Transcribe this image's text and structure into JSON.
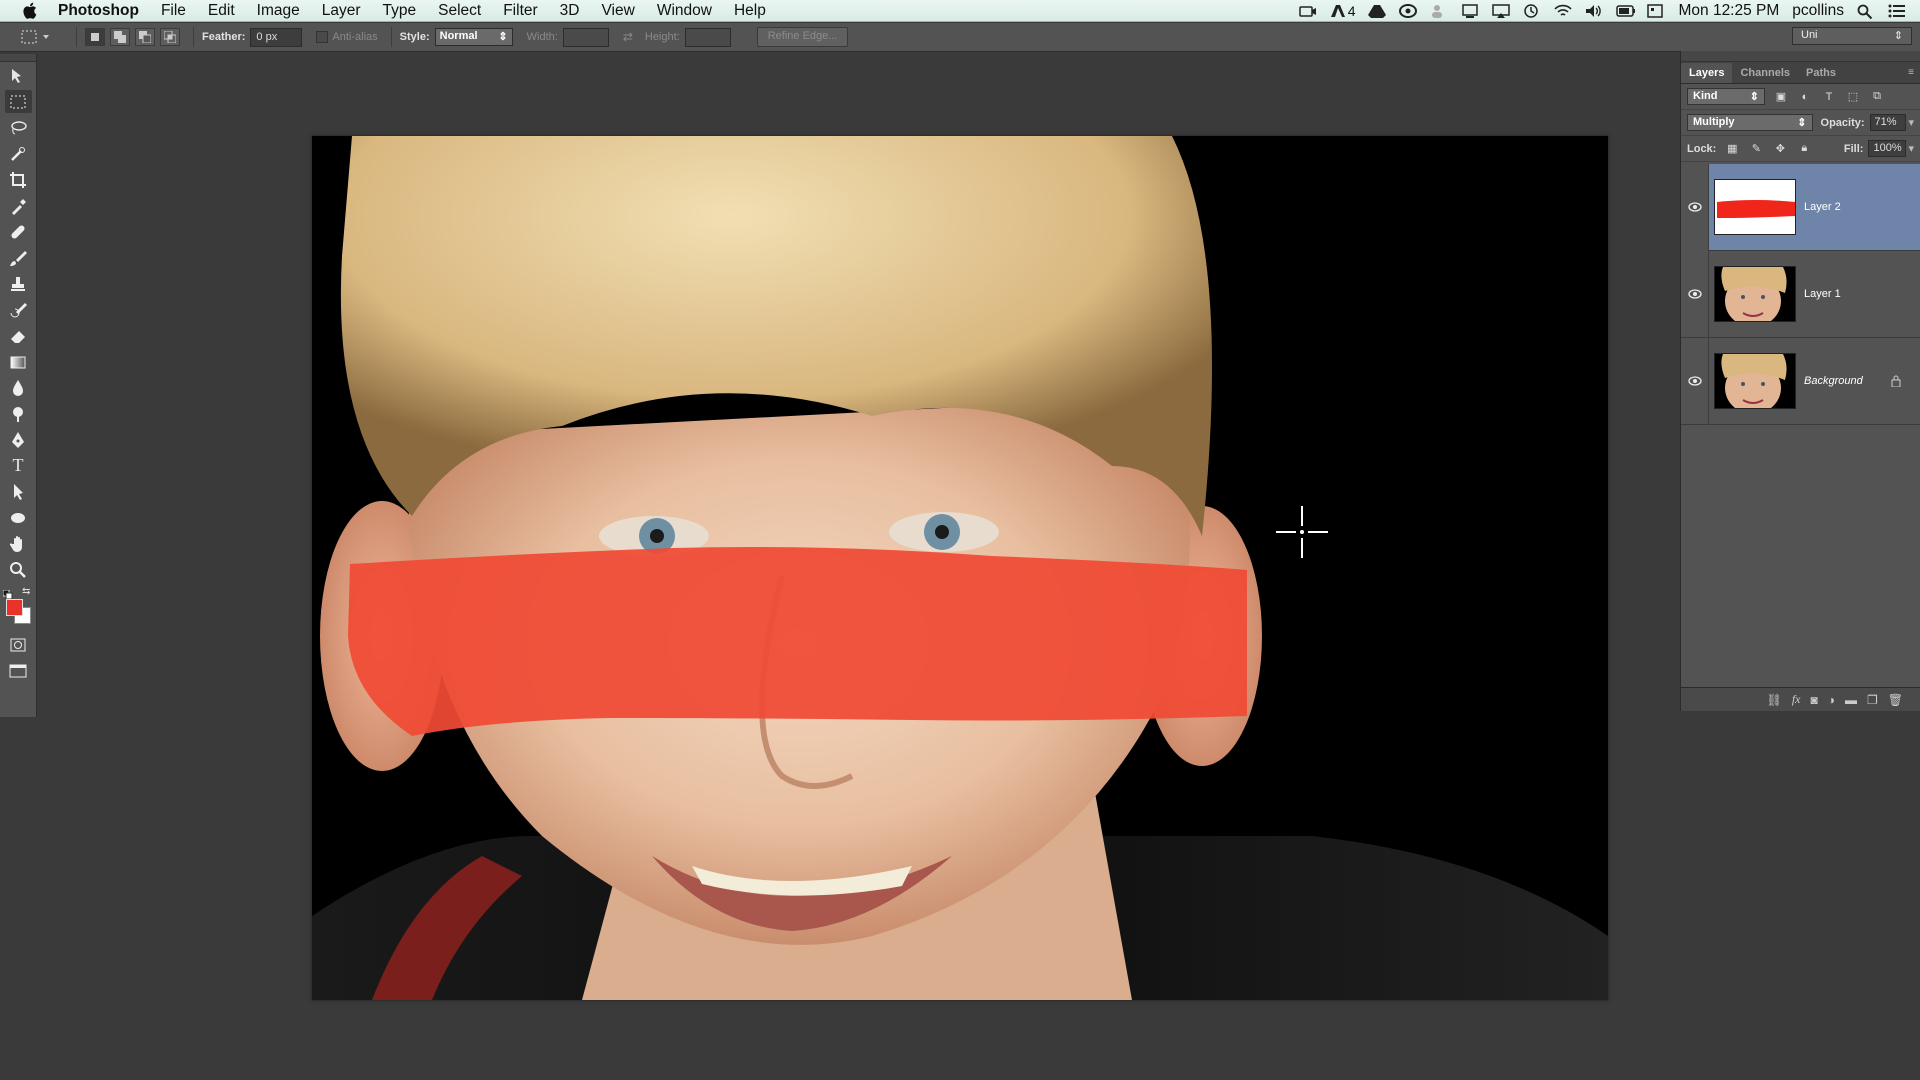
{
  "menubar": {
    "app_name": "Photoshop",
    "items": [
      "File",
      "Edit",
      "Image",
      "Layer",
      "Type",
      "Select",
      "Filter",
      "3D",
      "View",
      "Window",
      "Help"
    ],
    "status_number": "4",
    "clock": "Mon 12:25 PM",
    "user": "pcollins"
  },
  "options": {
    "feather_label": "Feather:",
    "feather_value": "0 px",
    "antialias_label": "Anti-alias",
    "style_label": "Style:",
    "style_value": "Normal",
    "width_label": "Width:",
    "height_label": "Height:",
    "refine_label": "Refine Edge...",
    "workspace": "Uni"
  },
  "layers_panel": {
    "tabs": [
      "Layers",
      "Channels",
      "Paths"
    ],
    "filter_kind": "Kind",
    "blend_mode": "Multiply",
    "opacity_label": "Opacity:",
    "opacity_value": "71%",
    "lock_label": "Lock:",
    "fill_label": "Fill:",
    "fill_value": "100%",
    "layers": [
      {
        "name": "Layer 2",
        "selected": true
      },
      {
        "name": "Layer 1",
        "selected": false
      },
      {
        "name": "Background",
        "selected": false
      }
    ]
  },
  "colors": {
    "foreground": "#e8322a",
    "background": "#ffffff",
    "paint_stripe": "#f04a35"
  }
}
